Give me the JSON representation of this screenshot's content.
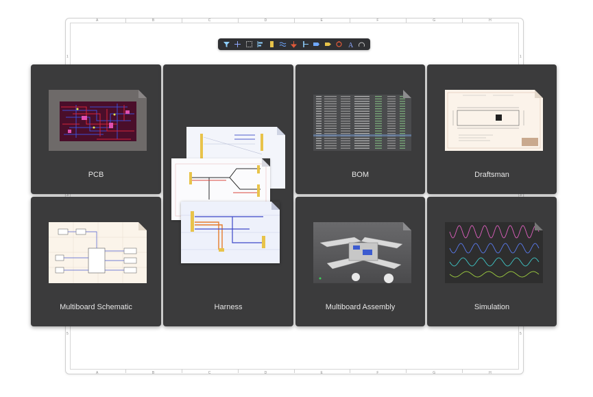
{
  "sheet": {
    "zone_columns": [
      "A",
      "B",
      "C",
      "D",
      "E",
      "F",
      "G",
      "H"
    ],
    "zone_rows": [
      "1",
      "2",
      "3",
      "4",
      "5"
    ]
  },
  "toolbar": {
    "tools": [
      {
        "icon": "filter-icon",
        "color": "#8fd0ff"
      },
      {
        "icon": "crosshair-icon",
        "color": "#8fa8ff"
      },
      {
        "icon": "select-rectangle-icon",
        "color": "#bdbdbd"
      },
      {
        "icon": "align-icon",
        "color": "#8fd0ff"
      },
      {
        "icon": "component-icon",
        "color": "#e8c34a"
      },
      {
        "icon": "wire-icon",
        "color": "#6fa8ff"
      },
      {
        "icon": "power-port-icon",
        "color": "#e05a3a"
      },
      {
        "icon": "bus-icon",
        "color": "#8fd0ff"
      },
      {
        "icon": "port-icon",
        "color": "#6fa8ff"
      },
      {
        "icon": "net-label-icon",
        "color": "#e8c34a"
      },
      {
        "icon": "directive-icon",
        "color": "#e05a3a"
      },
      {
        "icon": "text-icon",
        "color": "#8fa8ff"
      },
      {
        "icon": "arc-icon",
        "color": "#bdbdbd"
      }
    ]
  },
  "tiles": [
    {
      "id": "pcb",
      "label": "PCB"
    },
    {
      "id": "harness",
      "label": "Harness"
    },
    {
      "id": "bom",
      "label": "BOM"
    },
    {
      "id": "draftsman",
      "label": "Draftsman"
    },
    {
      "id": "multiboard-schematic",
      "label": "Multiboard Schematic"
    },
    {
      "id": "multiboard-assembly",
      "label": "Multiboard Assembly"
    },
    {
      "id": "simulation",
      "label": "Simulation"
    }
  ],
  "colors": {
    "tile_bg": "#3b3b3c",
    "label": "#e6e6e6",
    "pcb_board": "#5a1030",
    "draft_paper": "#fbf3ea",
    "sim_bg": "#2e2e2e"
  }
}
